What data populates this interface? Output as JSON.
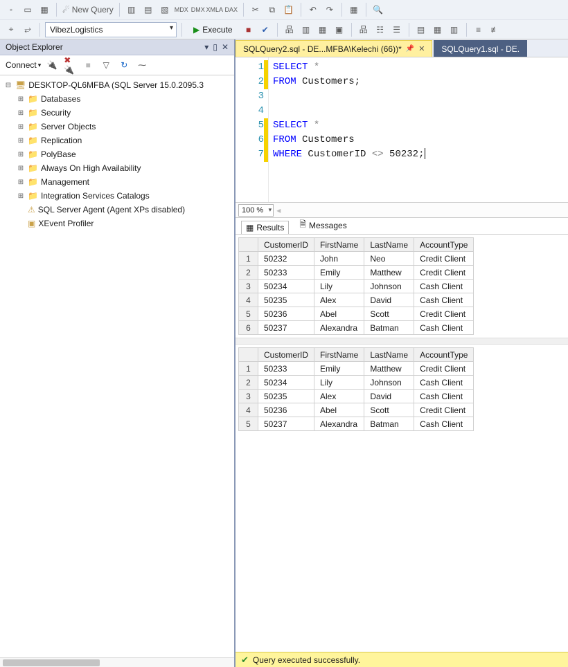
{
  "toolbar": {
    "database_selected": "VibezLogistics",
    "execute_label": "Execute",
    "new_query_label": "New Query"
  },
  "object_explorer": {
    "title": "Object Explorer",
    "connect_label": "Connect",
    "server_label": "DESKTOP-QL6MFBA (SQL Server 15.0.2095.3",
    "nodes": [
      "Databases",
      "Security",
      "Server Objects",
      "Replication",
      "PolyBase",
      "Always On High Availability",
      "Management",
      "Integration Services Catalogs",
      "SQL Server Agent (Agent XPs disabled)",
      "XEvent Profiler"
    ]
  },
  "tabs": {
    "active": "SQLQuery2.sql - DE...MFBA\\Kelechi (66))*",
    "inactive": "SQLQuery1.sql - DE."
  },
  "code": {
    "lines": [
      {
        "n": 1,
        "tokens": [
          [
            "kw",
            "SELECT"
          ],
          [
            "",
            " "
          ],
          [
            "op",
            "*"
          ]
        ],
        "fold": true
      },
      {
        "n": 2,
        "tokens": [
          [
            "kw",
            "FROM"
          ],
          [
            "",
            " Customers;"
          ]
        ]
      },
      {
        "n": 3,
        "tokens": []
      },
      {
        "n": 4,
        "tokens": []
      },
      {
        "n": 5,
        "tokens": [
          [
            "kw",
            "SELECT"
          ],
          [
            "",
            " "
          ],
          [
            "op",
            "*"
          ]
        ],
        "fold": true
      },
      {
        "n": 6,
        "tokens": [
          [
            "kw",
            "FROM"
          ],
          [
            "",
            " Customers"
          ]
        ]
      },
      {
        "n": 7,
        "tokens": [
          [
            "kw",
            "WHERE"
          ],
          [
            "",
            " CustomerID "
          ],
          [
            "op",
            "<>"
          ],
          [
            "",
            " 50232;"
          ]
        ],
        "caret": true
      }
    ]
  },
  "zoom": "100 %",
  "result_tabs": {
    "results": "Results",
    "messages": "Messages"
  },
  "grids": {
    "columns": [
      "CustomerID",
      "FirstName",
      "LastName",
      "AccountType"
    ],
    "grid1": [
      [
        "50232",
        "John",
        "Neo",
        "Credit Client"
      ],
      [
        "50233",
        "Emily",
        "Matthew",
        "Credit Client"
      ],
      [
        "50234",
        "Lily",
        "Johnson",
        "Cash Client"
      ],
      [
        "50235",
        "Alex",
        "David",
        "Cash Client"
      ],
      [
        "50236",
        "Abel",
        "Scott",
        "Credit Client"
      ],
      [
        "50237",
        "Alexandra",
        "Batman",
        "Cash Client"
      ]
    ],
    "grid2": [
      [
        "50233",
        "Emily",
        "Matthew",
        "Credit Client"
      ],
      [
        "50234",
        "Lily",
        "Johnson",
        "Cash Client"
      ],
      [
        "50235",
        "Alex",
        "David",
        "Cash Client"
      ],
      [
        "50236",
        "Abel",
        "Scott",
        "Credit Client"
      ],
      [
        "50237",
        "Alexandra",
        "Batman",
        "Cash Client"
      ]
    ]
  },
  "status": "Query executed successfully."
}
